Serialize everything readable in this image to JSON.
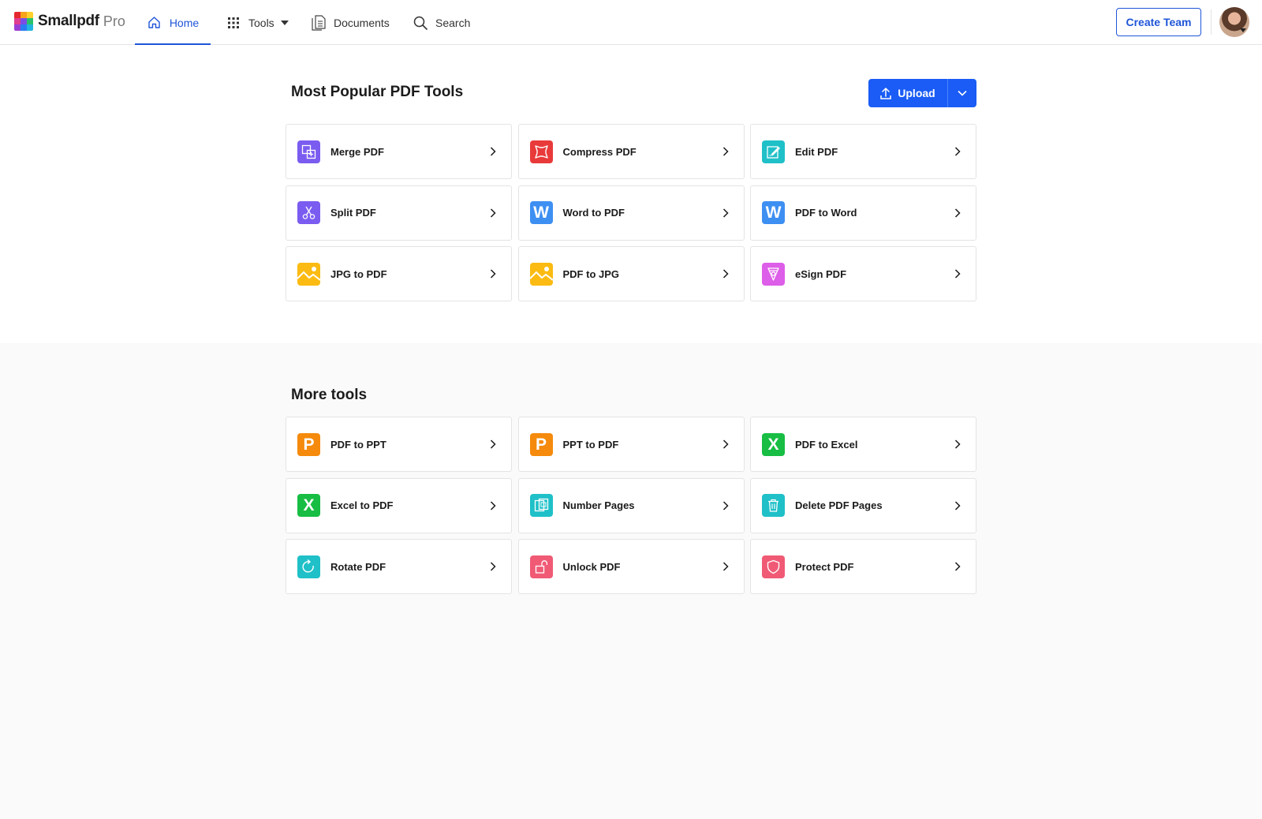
{
  "header": {
    "logo_name": "Smallpdf",
    "logo_tier": "Pro",
    "nav": {
      "home": "Home",
      "tools": "Tools",
      "documents": "Documents",
      "search": "Search"
    },
    "create_team": "Create Team"
  },
  "popular": {
    "title": "Most Popular PDF Tools",
    "upload_label": "Upload",
    "tools": [
      {
        "label": "Merge PDF",
        "icon": "merge-icon",
        "color": "#7b5cf0"
      },
      {
        "label": "Compress PDF",
        "icon": "compress-icon",
        "color": "#e93a3a"
      },
      {
        "label": "Edit PDF",
        "icon": "edit-icon",
        "color": "#1fc0c8"
      },
      {
        "label": "Split PDF",
        "icon": "scissors-icon",
        "color": "#7b5cf0"
      },
      {
        "label": "Word to PDF",
        "icon": "word-icon",
        "color": "#3d8ff2"
      },
      {
        "label": "PDF to Word",
        "icon": "word-icon",
        "color": "#3d8ff2"
      },
      {
        "label": "JPG to PDF",
        "icon": "image-icon",
        "color": "#fbbb12"
      },
      {
        "label": "PDF to JPG",
        "icon": "image-icon",
        "color": "#fbbb12"
      },
      {
        "label": "eSign PDF",
        "icon": "pen-nib-icon",
        "color": "#dd5ee8"
      }
    ]
  },
  "more": {
    "title": "More tools",
    "tools": [
      {
        "label": "PDF to PPT",
        "icon": "powerpoint-icon",
        "color": "#f58a0c"
      },
      {
        "label": "PPT to PDF",
        "icon": "powerpoint-icon",
        "color": "#f58a0c"
      },
      {
        "label": "PDF to Excel",
        "icon": "excel-icon",
        "color": "#18bd43"
      },
      {
        "label": "Excel to PDF",
        "icon": "excel-icon",
        "color": "#18bd43"
      },
      {
        "label": "Number Pages",
        "icon": "number-pages-icon",
        "color": "#1fc0c8"
      },
      {
        "label": "Delete PDF Pages",
        "icon": "trash-icon",
        "color": "#1fc0c8"
      },
      {
        "label": "Rotate PDF",
        "icon": "rotate-icon",
        "color": "#1fc0c8"
      },
      {
        "label": "Unlock PDF",
        "icon": "unlock-icon",
        "color": "#f05a75"
      },
      {
        "label": "Protect PDF",
        "icon": "shield-icon",
        "color": "#f05a75"
      }
    ]
  },
  "colors": {
    "accent": "#1a5cf5",
    "nav_active": "#1f55d8"
  }
}
